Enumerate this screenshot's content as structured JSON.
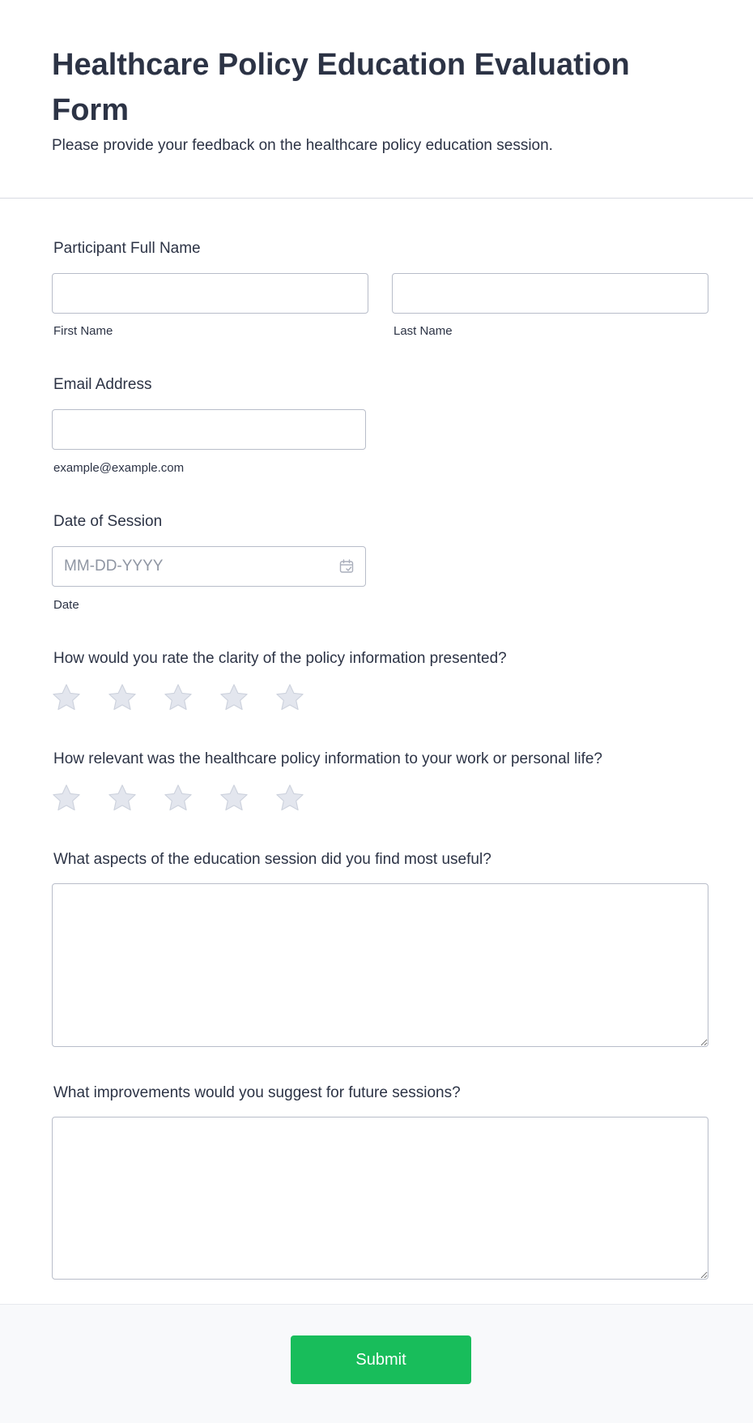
{
  "form": {
    "title": "Healthcare Policy Education Evaluation Form",
    "subtitle": "Please provide your feedback on the healthcare policy education session."
  },
  "fields": {
    "name": {
      "label": "Participant Full Name",
      "first_value": "",
      "last_value": "",
      "first_sublabel": "First Name",
      "last_sublabel": "Last Name"
    },
    "email": {
      "label": "Email Address",
      "value": "",
      "sublabel": "example@example.com"
    },
    "date": {
      "label": "Date of Session",
      "placeholder": "MM-DD-YYYY",
      "sublabel": "Date",
      "icon": "calendar-icon"
    },
    "clarity_rating": {
      "label": "How would you rate the clarity of the policy information presented?",
      "max": 5,
      "value": 0
    },
    "relevance_rating": {
      "label": "How relevant was the healthcare policy information to your work or personal life?",
      "max": 5,
      "value": 0
    },
    "useful_aspects": {
      "label": "What aspects of the education session did you find most useful?",
      "value": ""
    },
    "improvements": {
      "label": "What improvements would you suggest for future sessions?",
      "value": ""
    }
  },
  "submit": {
    "label": "Submit"
  },
  "colors": {
    "star_fill": "#e3e6ee",
    "star_stroke": "#cdd2dd",
    "submit_bg": "#18bd5b",
    "text": "#2c3345",
    "border": "#b8bdc9"
  }
}
